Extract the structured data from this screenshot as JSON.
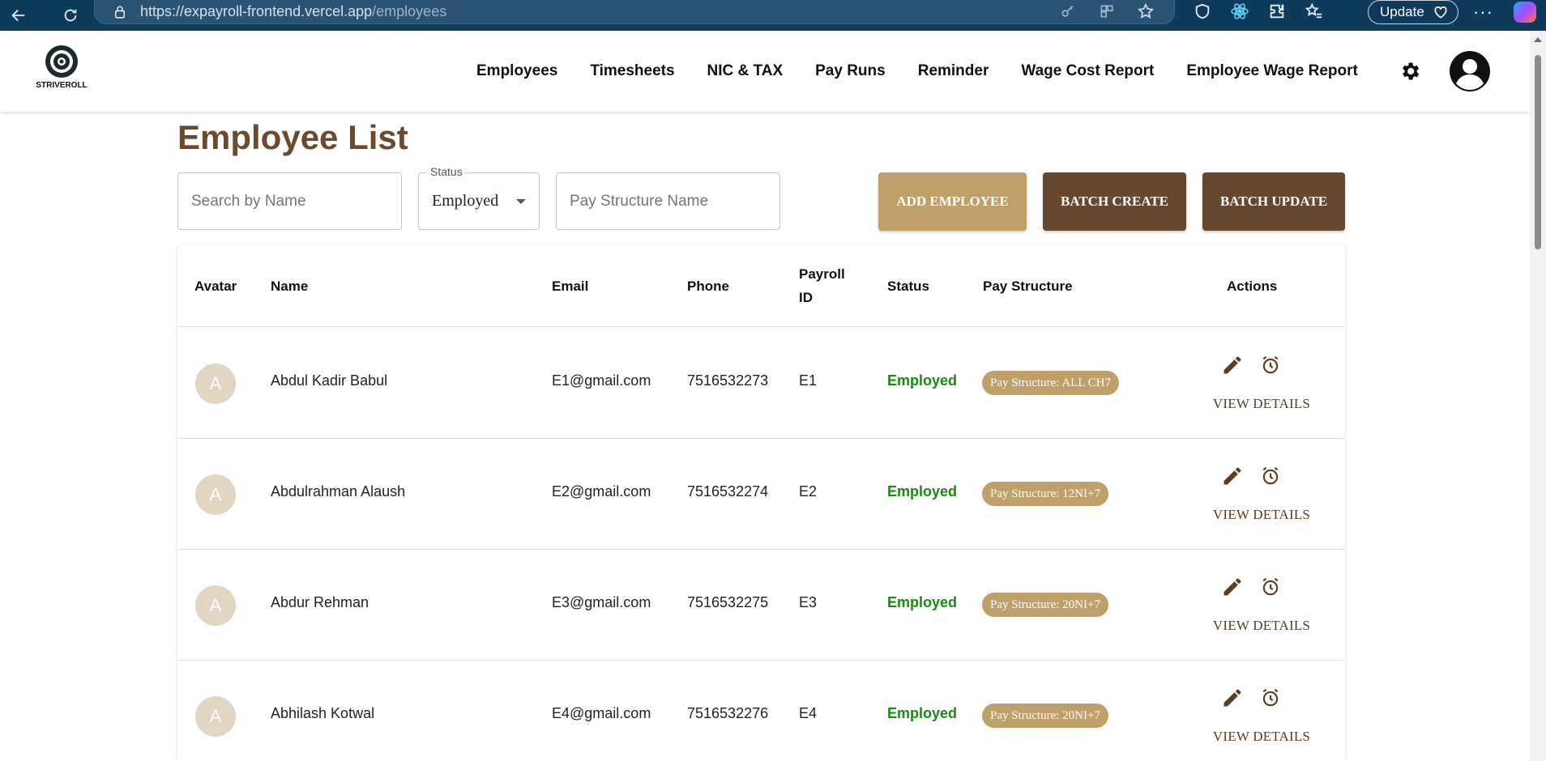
{
  "browser": {
    "url_host": "https://expayroll-frontend.vercel.app",
    "url_path": "/employees",
    "update_label": "Update"
  },
  "header": {
    "logo_text": "STRIVEROLL",
    "nav": [
      "Employees",
      "Timesheets",
      "NIC & TAX",
      "Pay Runs",
      "Reminder",
      "Wage Cost Report",
      "Employee Wage Report"
    ]
  },
  "page": {
    "title": "Employee List",
    "search_placeholder": "Search by Name",
    "status_label": "Status",
    "status_value": "Employed",
    "paystruct_placeholder": "Pay Structure Name",
    "buttons": {
      "add": "ADD EMPLOYEE",
      "batch_create": "BATCH CREATE",
      "batch_update": "BATCH UPDATE"
    }
  },
  "table": {
    "headers": {
      "avatar": "Avatar",
      "name": "Name",
      "email": "Email",
      "phone": "Phone",
      "payroll_line1": "Payroll",
      "payroll_line2": "ID",
      "status": "Status",
      "pay_structure": "Pay Structure",
      "actions": "Actions"
    },
    "view_details_label": "VIEW DETAILS",
    "rows": [
      {
        "initial": "A",
        "name": "Abdul Kadir Babul",
        "email": "E1@gmail.com",
        "phone": "7516532273",
        "payroll_id": "E1",
        "status": "Employed",
        "pay_structure": "Pay Structure: ALL CH7"
      },
      {
        "initial": "A",
        "name": "Abdulrahman Alaush",
        "email": "E2@gmail.com",
        "phone": "7516532274",
        "payroll_id": "E2",
        "status": "Employed",
        "pay_structure": "Pay Structure: 12NI+7"
      },
      {
        "initial": "A",
        "name": "Abdur Rehman",
        "email": "E3@gmail.com",
        "phone": "7516532275",
        "payroll_id": "E3",
        "status": "Employed",
        "pay_structure": "Pay Structure: 20NI+7"
      },
      {
        "initial": "A",
        "name": "Abhilash Kotwal",
        "email": "E4@gmail.com",
        "phone": "7516532276",
        "payroll_id": "E4",
        "status": "Employed",
        "pay_structure": "Pay Structure: 20NI+7"
      }
    ]
  },
  "colors": {
    "brand_brown": "#65482f",
    "brand_gold": "#bfa06a",
    "title_brown": "#6b4a2e",
    "status_green": "#1a8a12"
  }
}
